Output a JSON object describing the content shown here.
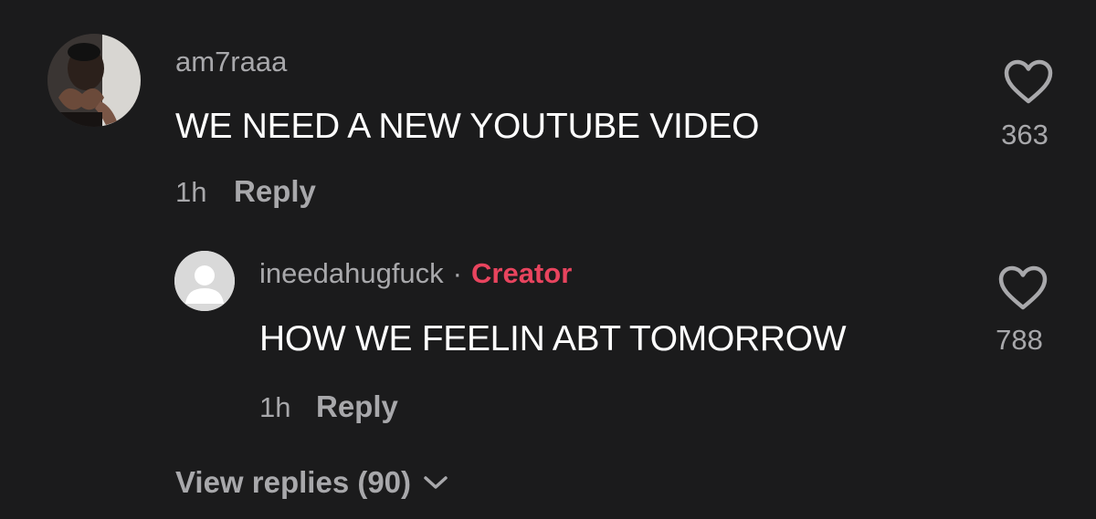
{
  "comment": {
    "username": "am7raaa",
    "text": "WE NEED A NEW YOUTUBE VIDEO",
    "time": "1h",
    "reply_label": "Reply",
    "likes": "363",
    "like_icon": "heart-outline-icon"
  },
  "reply": {
    "username": "ineedahugfuck",
    "separator": "·",
    "badge": "Creator",
    "text": "HOW WE FEELIN ABT TOMORROW",
    "time": "1h",
    "reply_label": "Reply",
    "likes": "788",
    "like_icon": "heart-outline-icon"
  },
  "view_replies": {
    "label": "View replies (90)",
    "icon": "chevron-down-icon"
  },
  "colors": {
    "background": "#1b1b1c",
    "primary_text": "#ffffff",
    "secondary_text": "#a8a8ab",
    "creator_accent": "#e8445e"
  }
}
